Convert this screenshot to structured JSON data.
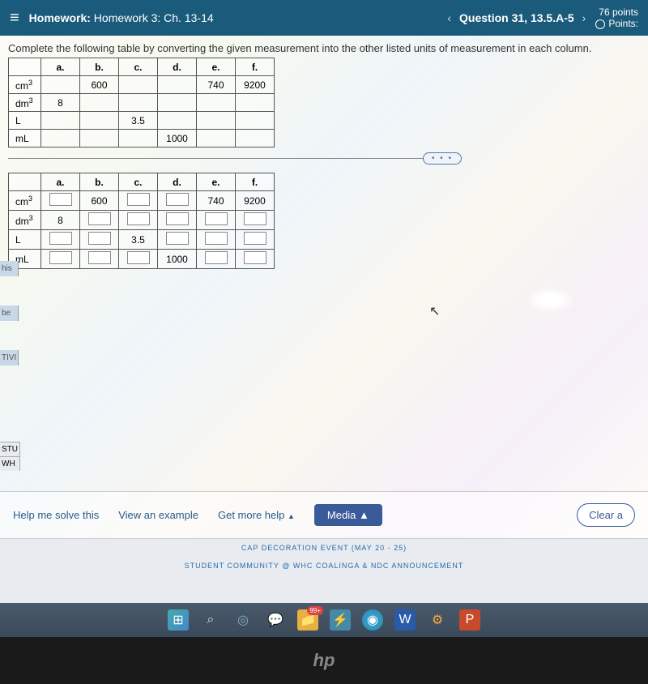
{
  "header": {
    "homework_label": "Homework:",
    "homework_title": "Homework 3: Ch. 13-14",
    "question_label": "Question 31, 13.5.A-5",
    "score_points": "76 points",
    "points_label": "Points:"
  },
  "instruction": "Complete the following table by converting the given measurement into the other listed units of measurement in each column.",
  "columns": [
    "a.",
    "b.",
    "c.",
    "d.",
    "e.",
    "f."
  ],
  "row_units": [
    "cm",
    "dm",
    "L",
    "mL"
  ],
  "row_exp": [
    "3",
    "3",
    "",
    ""
  ],
  "table1": {
    "cm3": [
      "",
      "600",
      "",
      "",
      "740",
      "9200"
    ],
    "dm3": [
      "8",
      "",
      "",
      "",
      "",
      ""
    ],
    "L": [
      "",
      "",
      "3.5",
      "",
      "",
      ""
    ],
    "mL": [
      "",
      "",
      "",
      "1000",
      "",
      ""
    ]
  },
  "table2_given": {
    "cm3": {
      "b": "600",
      "e": "740",
      "f": "9200"
    },
    "dm3": {
      "a": "8"
    },
    "L": {
      "c": "3.5"
    },
    "mL": {
      "d": "1000"
    }
  },
  "ellipsis": "• • •",
  "side": {
    "his": "his",
    "be": "be",
    "tivi": "TIVI",
    "stu": "STU",
    "wh": "WH"
  },
  "bottom": {
    "help": "Help me solve this",
    "example": "View an example",
    "more": "Get more help",
    "media": "Media",
    "clear": "Clear a"
  },
  "below": {
    "line1": "CAP DECORATION EVENT (MAY 20 - 25)",
    "line2": "STUDENT COMMUNITY @ WHC COALINGA & NDC ANNOUNCEMENT"
  },
  "taskbar": {
    "badge": "99+",
    "word": "W",
    "ppt": "P"
  },
  "logo": "hp"
}
